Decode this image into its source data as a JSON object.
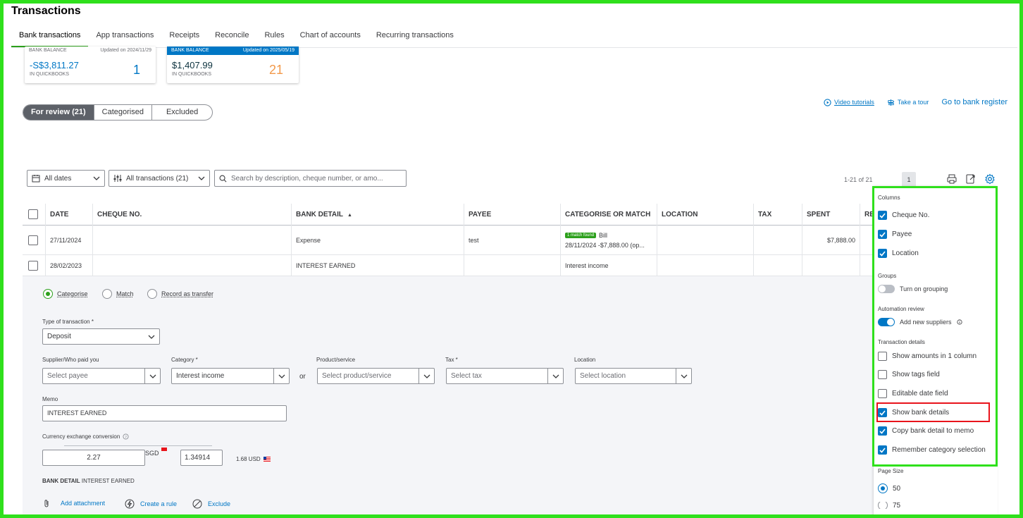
{
  "page_title": "Transactions",
  "tabs": [
    {
      "label": "Bank transactions",
      "active": true
    },
    {
      "label": "App transactions"
    },
    {
      "label": "Receipts"
    },
    {
      "label": "Reconcile"
    },
    {
      "label": "Rules"
    },
    {
      "label": "Chart of accounts"
    },
    {
      "label": "Recurring transactions"
    }
  ],
  "cards": [
    {
      "header": "BANK BALANCE",
      "updated": "Updated on 2024/11/29",
      "balance": "-S$3,811.27",
      "sub": "IN QUICKBOOKS",
      "count": "1"
    },
    {
      "header": "BANK BALANCE",
      "updated": "Updated on 2025/05/19",
      "balance": "$1,407.99",
      "sub": "IN QUICKBOOKS",
      "count": "21"
    }
  ],
  "review_tabs": {
    "for_review": "For review (21)",
    "categorised": "Categorised",
    "excluded": "Excluded"
  },
  "links": {
    "video": "Video tutorials",
    "tour": "Take a tour",
    "register": "Go to bank register"
  },
  "filters": {
    "dates": "All dates",
    "transactions": "All transactions (21)",
    "search_placeholder": "Search by description, cheque number, or amo..."
  },
  "pager": {
    "range": "1-21 of 21",
    "page": "1"
  },
  "table": {
    "headers": {
      "date": "DATE",
      "cheque": "CHEQUE NO.",
      "bank_detail": "BANK DETAIL",
      "payee": "PAYEE",
      "categorise": "CATEGORISE OR MATCH",
      "location": "LOCATION",
      "tax": "TAX",
      "spent": "SPENT",
      "received": "RE"
    },
    "rows": [
      {
        "date": "27/11/2024",
        "bank_detail": "Expense",
        "payee": "test",
        "match_badge": "1 match found",
        "match_type": "Bill",
        "match_detail": "28/11/2024 -$7,888.00 (op...",
        "spent": "$7,888.00"
      },
      {
        "date": "28/02/2023",
        "bank_detail": "INTEREST EARNED",
        "category": "Interest income"
      }
    ]
  },
  "detail": {
    "radios": {
      "categorise": "Categorise",
      "match": "Match",
      "transfer": "Record as transfer"
    },
    "type_label": "Type of transaction *",
    "type_value": "Deposit",
    "supplier_label": "Supplier/Who paid you",
    "supplier_placeholder": "Select payee",
    "category_label": "Category *",
    "category_value": "Interest income",
    "or": "or",
    "product_label": "Product/service",
    "product_placeholder": "Select product/service",
    "tax_label": "Tax *",
    "tax_placeholder": "Select tax",
    "location_label": "Location",
    "location_placeholder": "Select location",
    "memo_label": "Memo",
    "memo_value": "INTEREST EARNED",
    "currency_label": "Currency exchange conversion",
    "amount": "2.27",
    "currency": "SGD",
    "rate": "1.34914",
    "usd": "1.68 USD",
    "bank_detail_label": "BANK DETAIL",
    "bank_detail_value": "INTEREST EARNED",
    "add_attachment": "Add attachment",
    "create_rule": "Create a rule",
    "exclude": "Exclude"
  },
  "settings": {
    "columns_title": "Columns",
    "columns": [
      {
        "label": "Cheque No.",
        "checked": true
      },
      {
        "label": "Payee",
        "checked": true
      },
      {
        "label": "Location",
        "checked": true
      }
    ],
    "groups_title": "Groups",
    "grouping_label": "Turn on grouping",
    "automation_title": "Automation review",
    "suppliers_label": "Add new suppliers",
    "details_title": "Transaction details",
    "details": [
      {
        "label": "Show amounts in 1 column",
        "checked": false
      },
      {
        "label": "Show tags field",
        "checked": false
      },
      {
        "label": "Editable date field",
        "checked": false
      },
      {
        "label": "Show bank details",
        "checked": true
      },
      {
        "label": "Copy bank detail to memo",
        "checked": true
      },
      {
        "label": "Remember category selection",
        "checked": true
      }
    ],
    "page_size_title": "Page Size",
    "page_size_options": [
      "50",
      "75"
    ]
  },
  "colors": {
    "accent_green": "#2ca01c",
    "blue": "#0077c5",
    "highlight_frame": "#2fe01c",
    "red_box": "#e8141b"
  }
}
